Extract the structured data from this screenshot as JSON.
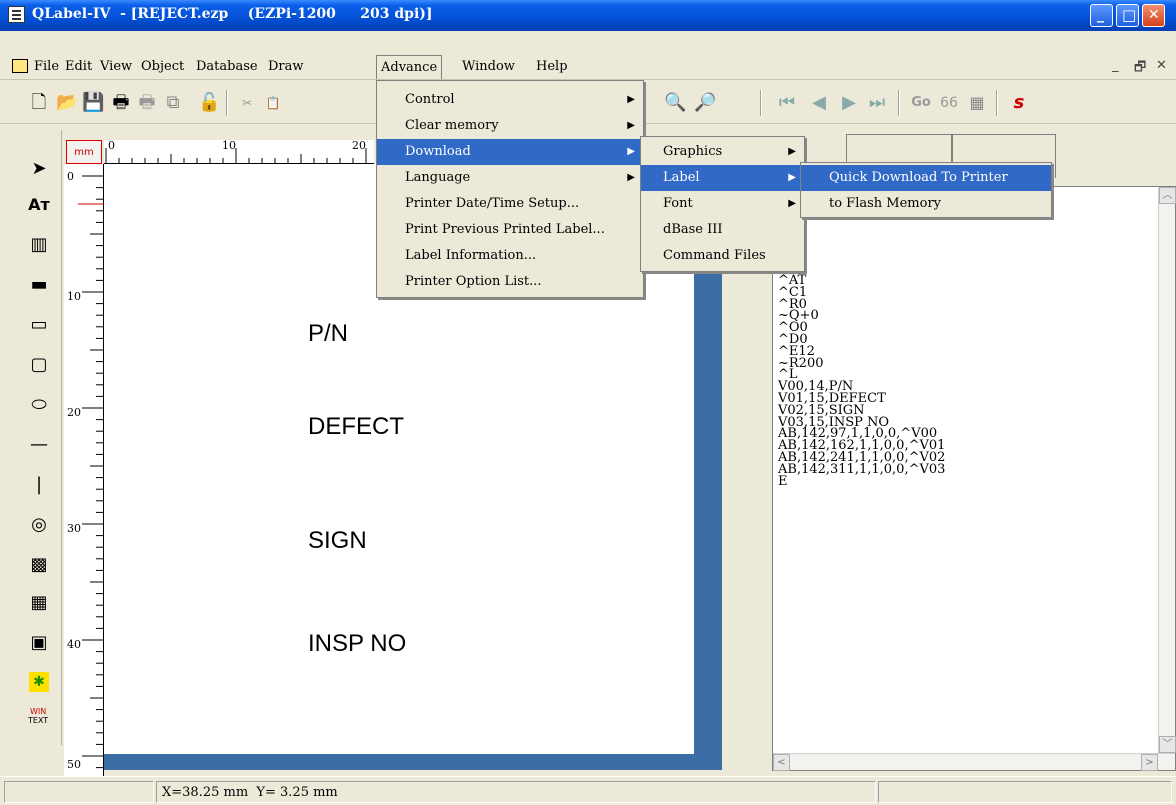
{
  "window": {
    "title": "QLabel-IV  - [REJECT.ezp    (EZPi-1200     203 dpi)]",
    "minimize_glyph": "_",
    "maximize_glyph": "□",
    "close_glyph": "✕"
  },
  "menubar": {
    "items": [
      {
        "label": "File",
        "key": "F"
      },
      {
        "label": "Edit",
        "key": "E"
      },
      {
        "label": "View",
        "key": "V"
      },
      {
        "label": "Object",
        "key": "O"
      },
      {
        "label": "Database",
        "key": "D"
      },
      {
        "label": "Draw",
        "key": "D"
      },
      {
        "label": "Advance",
        "key": "A"
      },
      {
        "label": "Window",
        "key": "W"
      },
      {
        "label": "Help",
        "key": "H"
      }
    ],
    "mdi_controls": [
      "_",
      "🗗",
      "✕"
    ]
  },
  "toolbar": {
    "go_label": "Go",
    "icons": [
      "new-file-icon",
      "open-folder-icon",
      "save-icon",
      "print-icon",
      "print-preview-icon",
      "copy-icon",
      "unlock-icon",
      "zoom-out-icon",
      "zoom-in-icon",
      "first-record-icon",
      "prev-record-icon",
      "next-record-icon",
      "last-record-icon",
      "find-icon",
      "calculator-icon",
      "currency-icon"
    ]
  },
  "toolbox": {
    "icons": [
      "pointer-icon",
      "text-icon",
      "barcode-icon",
      "filled-rect-icon",
      "rectangle-icon",
      "rounded-rect-icon",
      "ellipse-icon",
      "horizontal-line-icon",
      "vertical-line-icon",
      "maxicode-icon",
      "pdf417-icon",
      "datamatrix-icon",
      "qrcode-icon",
      "image-icon",
      "win-text-icon"
    ],
    "win_text_top": "WIN",
    "win_text_bottom": "TEXT"
  },
  "ruler": {
    "unit": "mm",
    "top_labels": [
      "0",
      "10",
      "20"
    ],
    "left_labels": [
      "0",
      "10",
      "20",
      "30",
      "40",
      "50"
    ]
  },
  "label": {
    "texts": [
      "P/N",
      "DEFECT",
      "SIGN",
      "INSP NO"
    ]
  },
  "advance_menu": {
    "items": [
      {
        "label": "Control",
        "submenu": true
      },
      {
        "label": "Clear memory",
        "submenu": true
      },
      {
        "label": "Download",
        "submenu": true,
        "highlighted": true
      },
      {
        "label": "Language",
        "submenu": true
      },
      {
        "label": "Printer Date/Time Setup...",
        "submenu": false
      },
      {
        "label": "Print Previous Printed Label...",
        "submenu": false
      },
      {
        "label": "Label Information...",
        "submenu": false
      },
      {
        "label": "Printer Option List...",
        "submenu": false
      }
    ]
  },
  "download_menu": {
    "items": [
      {
        "label": "Graphics",
        "submenu": true
      },
      {
        "label": "Label",
        "submenu": true,
        "highlighted": true
      },
      {
        "label": "Font",
        "submenu": true
      },
      {
        "label": "dBase III",
        "submenu": false
      },
      {
        "label": "Command Files",
        "submenu": false
      }
    ]
  },
  "label_menu": {
    "items": [
      {
        "label": "Quick Download To Printer",
        "highlighted": true
      },
      {
        "label": "to Flash Memory",
        "highlighted": false
      }
    ]
  },
  "code": {
    "partial_first": "5",
    "lines": [
      "^AT",
      "^C1",
      "^R0",
      "~Q+0",
      "^O0",
      "^D0",
      "^E12",
      "~R200",
      "^L",
      "V00,14,P/N",
      "V01,15,DEFECT",
      "V02,15,SIGN",
      "V03,15,INSP NO",
      "AB,142,97,1,1,0,0,^V00",
      "AB,142,162,1,1,0,0,^V01",
      "AB,142,241,1,1,0,0,^V02",
      "AB,142,311,1,1,0,0,^V03",
      "E"
    ]
  },
  "status": {
    "coords": "X=38.25 mm  Y= 3.25 mm"
  },
  "colors": {
    "title_blue": "#0451d6",
    "menu_highlight": "#3169c6",
    "frame_blue": "#3a6ea5",
    "arrow_blue": "#1c2fd6",
    "arrow_red": "#d40000"
  }
}
